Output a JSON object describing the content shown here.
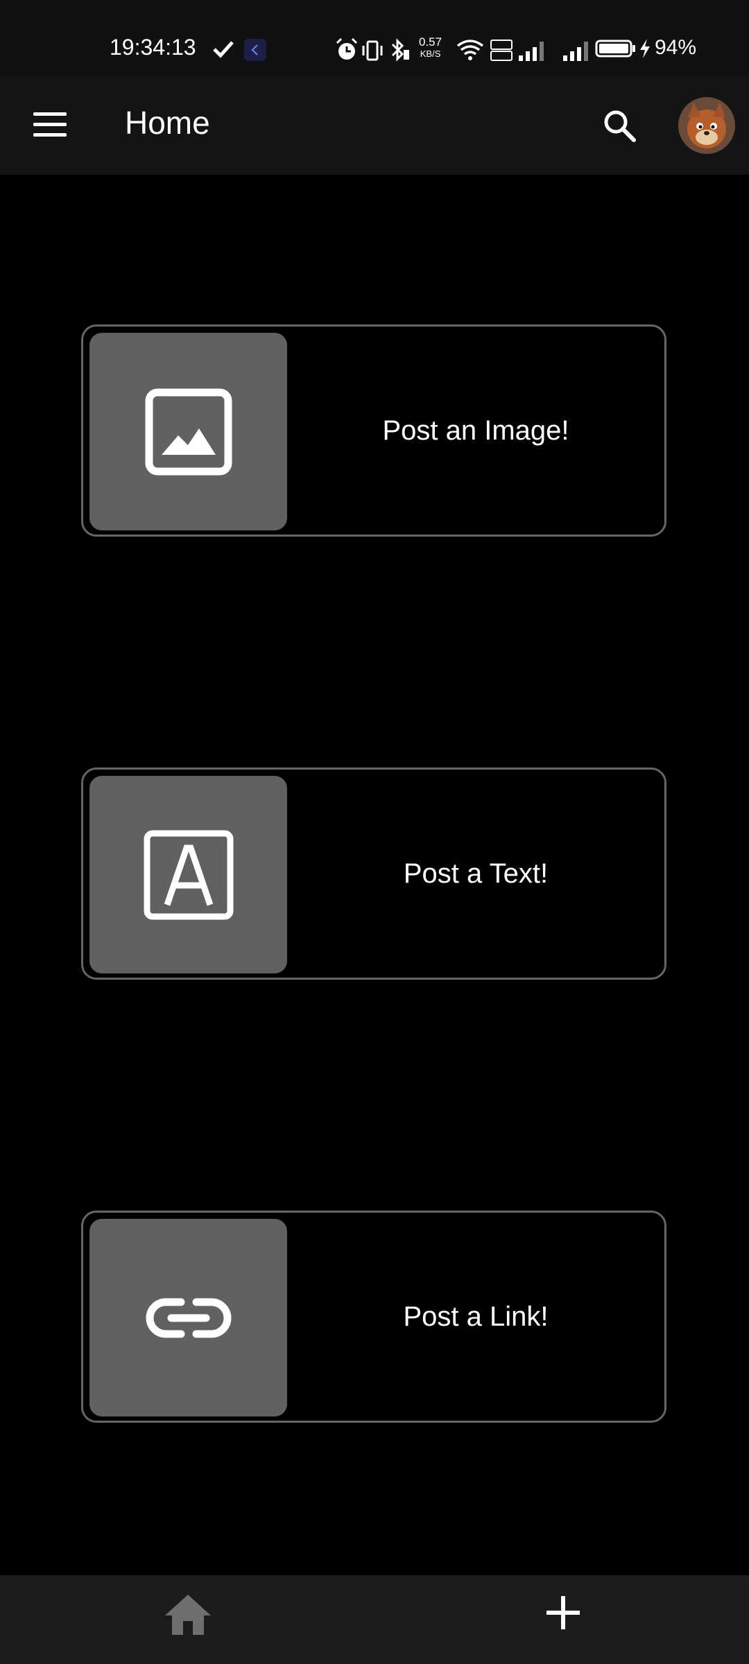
{
  "status_bar": {
    "time": "19:34:13",
    "network_speed_value": "0.57",
    "network_speed_unit": "KB/S",
    "battery_percent": "94%",
    "icons": [
      "check-icon",
      "app-notification-icon",
      "alarm-icon",
      "vibrate-icon",
      "bluetooth-icon",
      "wifi-icon",
      "volte-icon",
      "signal-icon",
      "battery-icon",
      "charging-icon"
    ]
  },
  "app_bar": {
    "title": "Home",
    "icons": [
      "menu-icon",
      "search-icon",
      "avatar"
    ]
  },
  "cards": [
    {
      "label": "Post an Image!",
      "icon": "image-icon"
    },
    {
      "label": "Post a Text!",
      "icon": "text-icon"
    },
    {
      "label": "Post a Link!",
      "icon": "link-icon"
    }
  ],
  "bottom_nav": {
    "items": [
      {
        "icon": "home-icon",
        "active": false
      },
      {
        "icon": "add-icon",
        "active": true
      }
    ]
  },
  "colors": {
    "background": "#000000",
    "bar": "#141414",
    "tile": "#616161",
    "card_border": "#666666",
    "nav_inactive": "#6f6f6f",
    "text": "#ffffff"
  }
}
